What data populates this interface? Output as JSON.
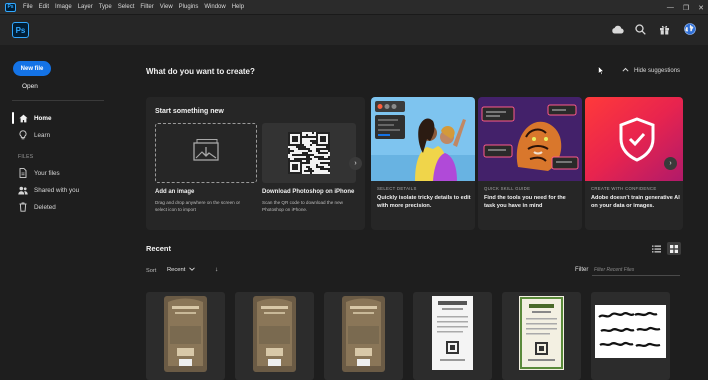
{
  "menu": [
    "File",
    "Edit",
    "Image",
    "Layer",
    "Type",
    "Select",
    "Filter",
    "View",
    "Plugins",
    "Window",
    "Help"
  ],
  "menu_logo": "Ps",
  "app_logo": "Ps",
  "window_controls": {
    "minimize": "—",
    "restore": "❐",
    "close": "✕"
  },
  "header_icons": [
    "cloud-icon",
    "search-icon",
    "gift-icon",
    "globe-icon"
  ],
  "sidebar": {
    "new_file": "New file",
    "open": "Open",
    "nav": [
      {
        "label": "Home",
        "icon": "home-icon",
        "active": true
      },
      {
        "label": "Learn",
        "icon": "lightbulb-icon",
        "active": false
      }
    ],
    "files_section": "FILES",
    "files": [
      {
        "label": "Your files",
        "icon": "document-icon"
      },
      {
        "label": "Shared with you",
        "icon": "people-icon"
      },
      {
        "label": "Deleted",
        "icon": "trash-icon"
      }
    ]
  },
  "main": {
    "title": "What do you want to create?",
    "hide_suggestions": "Hide suggestions",
    "start": {
      "title": "Start something new",
      "options": [
        {
          "title": "Add an image",
          "desc": "Drag and drop anywhere on the screen or select icon to import"
        },
        {
          "title": "Download Photoshop on iPhone",
          "desc": "Scan the QR code to download the new Photoshop on iPhone."
        }
      ]
    },
    "suggestions": [
      {
        "tag": "SELECT DETAILS",
        "desc": "Quickly isolate tricky details to edit with more precision."
      },
      {
        "tag": "QUICK SKILL GUIDE",
        "desc": "Find the tools you need for the task you have in mind"
      },
      {
        "tag": "CREATE WITH CONFIDENCE",
        "desc": "Adobe doesn't train generative AI on your data or images."
      }
    ]
  },
  "recent": {
    "title": "Recent",
    "sort_label": "Sort",
    "sort_value": "Recent",
    "sort_dir": "↓",
    "filter_label": "Filter",
    "filter_placeholder": "Filter Recent Files"
  },
  "colors": {
    "accent": "#1473e6",
    "ps_blue": "#31a8ff",
    "bg": "#1e1e1e",
    "card": "#262626"
  }
}
